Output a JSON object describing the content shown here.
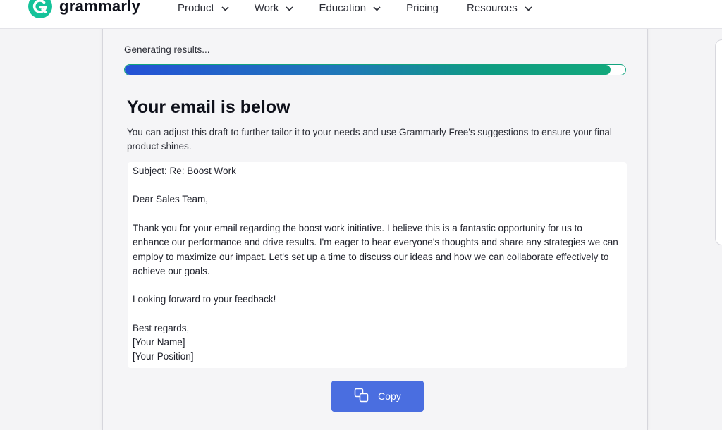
{
  "brand": {
    "name": "grammarly",
    "color": "#15c39a"
  },
  "nav": {
    "items": [
      {
        "label": "Product",
        "has_dropdown": true
      },
      {
        "label": "Work",
        "has_dropdown": true
      },
      {
        "label": "Education",
        "has_dropdown": true
      },
      {
        "label": "Pricing",
        "has_dropdown": false
      },
      {
        "label": "Resources",
        "has_dropdown": true
      }
    ]
  },
  "progress": {
    "label": "Generating results...",
    "percent": 97,
    "colors": [
      "#2451d6",
      "#12a87c"
    ]
  },
  "result": {
    "title": "Your email is below",
    "description": "You can adjust this draft to further tailor it to your needs and use Grammarly Free's suggestions to ensure your final product shines."
  },
  "email": {
    "subject": "Subject: Re: Boost Work",
    "greeting": "Dear Sales Team,",
    "body": "Thank you for your email regarding the boost work initiative. I believe this is a fantastic opportunity for us to enhance our performance and drive results. I'm eager to hear everyone's thoughts and share any strategies we can employ to maximize our impact. Let's set up a time to discuss our ideas and how we can collaborate effectively to achieve our goals.",
    "closing_line": "Looking forward to your feedback!",
    "sign_off": "Best regards,",
    "name": "[Your Name]",
    "position": "[Your Position]"
  },
  "actions": {
    "copy_label": "Copy",
    "copy_icon": "copy-icon",
    "accent": "#4a6ee0"
  }
}
